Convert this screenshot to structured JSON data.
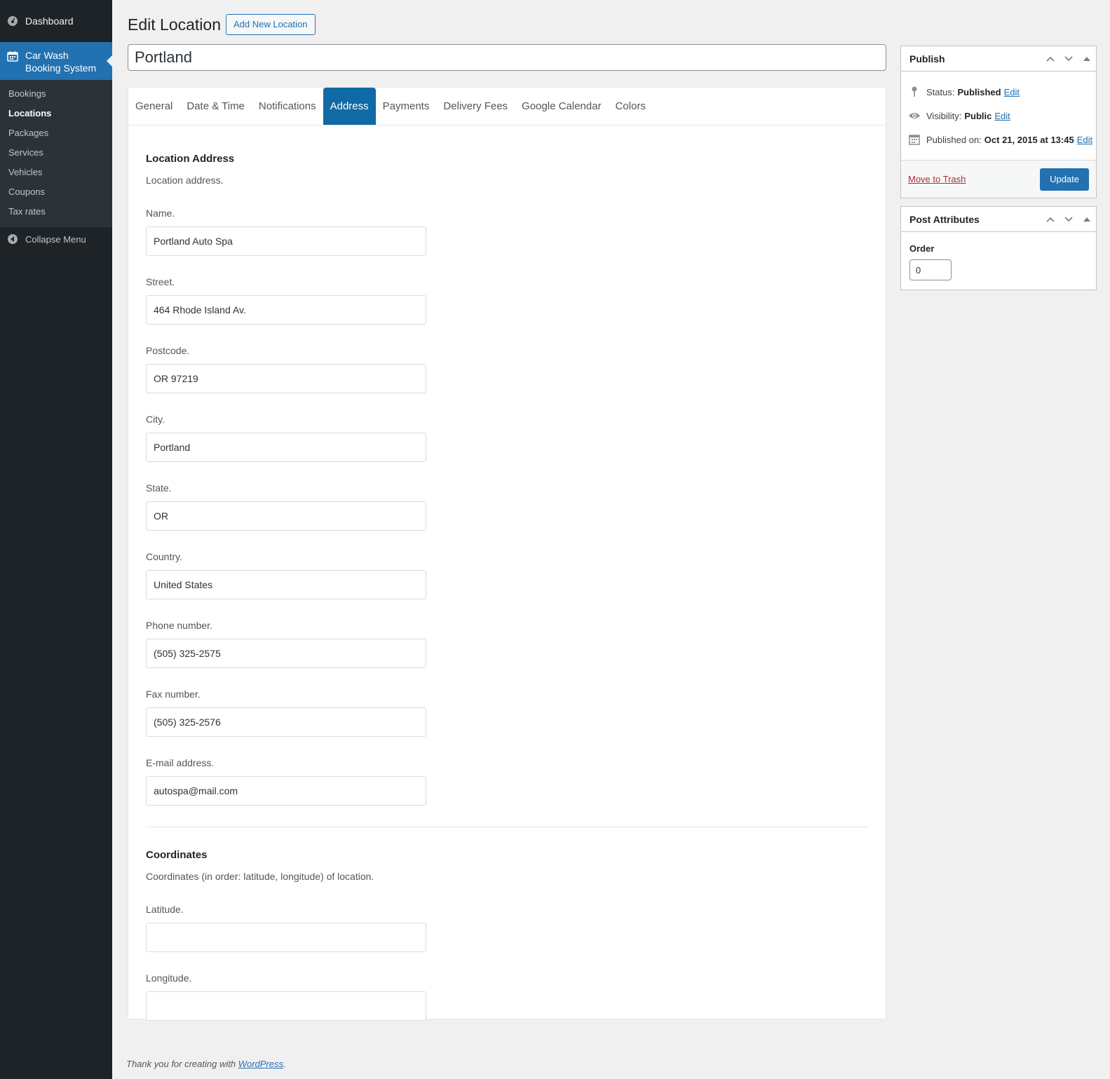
{
  "sidebar": {
    "dashboard_label": "Dashboard",
    "current_menu_line1": "Car Wash",
    "current_menu_line2": "Booking System",
    "submenu": [
      "Bookings",
      "Locations",
      "Packages",
      "Services",
      "Vehicles",
      "Coupons",
      "Tax rates"
    ],
    "active_submenu": "Locations",
    "collapse_label": "Collapse Menu"
  },
  "header": {
    "title": "Edit Location",
    "add_new_label": "Add New Location",
    "post_title_value": "Portland"
  },
  "tabs": [
    "General",
    "Date & Time",
    "Notifications",
    "Address",
    "Payments",
    "Delivery Fees",
    "Google Calendar",
    "Colors"
  ],
  "active_tab": "Address",
  "address_section": {
    "title": "Location Address",
    "description": "Location address.",
    "fields": [
      {
        "label": "Name.",
        "value": "Portland Auto Spa"
      },
      {
        "label": "Street.",
        "value": "464 Rhode Island Av."
      },
      {
        "label": "Postcode.",
        "value": "OR 97219"
      },
      {
        "label": "City.",
        "value": "Portland"
      },
      {
        "label": "State.",
        "value": "OR"
      },
      {
        "label": "Country.",
        "value": "United States"
      },
      {
        "label": "Phone number.",
        "value": "(505) 325-2575"
      },
      {
        "label": "Fax number.",
        "value": "(505) 325-2576"
      },
      {
        "label": "E-mail address.",
        "value": "autospa@mail.com"
      }
    ]
  },
  "coordinates_section": {
    "title": "Coordinates",
    "description": "Coordinates (in order: latitude, longitude) of location.",
    "fields": [
      {
        "label": "Latitude.",
        "value": ""
      },
      {
        "label": "Longitude.",
        "value": ""
      }
    ]
  },
  "publish": {
    "title": "Publish",
    "status_label": "Status:",
    "status_value": "Published",
    "visibility_label": "Visibility:",
    "visibility_value": "Public",
    "published_label": "Published on:",
    "published_value": "Oct 21, 2015 at 13:45",
    "edit_label": "Edit",
    "trash_label": "Move to Trash",
    "update_label": "Update"
  },
  "post_attributes": {
    "title": "Post Attributes",
    "order_label": "Order",
    "order_value": "0"
  },
  "footer": {
    "text": "Thank you for creating with ",
    "link": "WordPress",
    "suffix": "."
  },
  "colors": {
    "sidebar_bg": "#1d2327",
    "accent": "#2271b1",
    "active_tab": "#0f6aa6",
    "trash": "#b32d2e"
  }
}
